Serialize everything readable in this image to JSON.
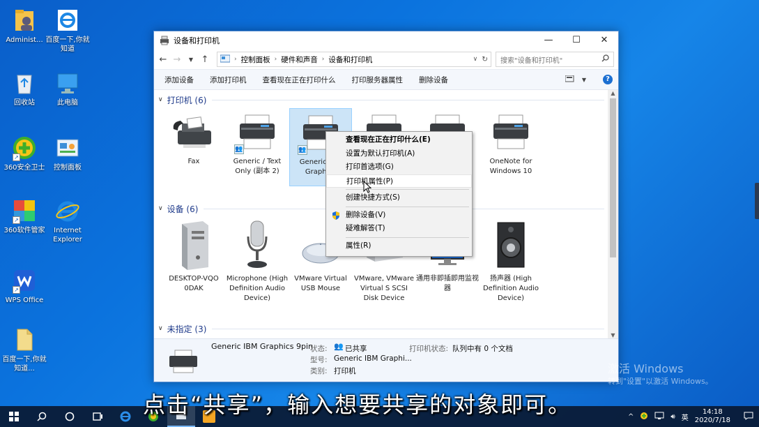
{
  "desktop": {
    "icons": [
      {
        "label": "Administ..."
      },
      {
        "label": "百度一下,你就知道"
      },
      {
        "label": "回收站"
      },
      {
        "label": "此电脑"
      },
      {
        "label": "360安全卫士"
      },
      {
        "label": "控制面板"
      },
      {
        "label": "360软件管家"
      },
      {
        "label": "Internet Explorer"
      },
      {
        "label": "WPS Office"
      },
      {
        "label": "百度一下,你就知道..."
      }
    ]
  },
  "window": {
    "title": "设备和打印机",
    "controls": {
      "minimize": "—",
      "maximize": "☐",
      "close": "✕"
    },
    "breadcrumb": [
      "控制面板",
      "硬件和声音",
      "设备和打印机"
    ],
    "search_placeholder": "搜索\"设备和打印机\"",
    "commands": [
      "添加设备",
      "添加打印机",
      "查看现在正在打印什么",
      "打印服务器属性",
      "删除设备"
    ],
    "help": "?"
  },
  "groups": {
    "printers": {
      "header": "打印机 (6)"
    },
    "devices": {
      "header": "设备 (6)"
    },
    "unspecified": {
      "header": "未指定 (3)"
    }
  },
  "printers": [
    {
      "label": "Fax"
    },
    {
      "label": "Generic / Text Only (副本 2)"
    },
    {
      "label": "Generic IBM Graphics"
    },
    {
      "label": ""
    },
    {
      "label": ""
    },
    {
      "label": "OneNote for Windows 10"
    }
  ],
  "devices": [
    {
      "label": "DESKTOP-VQO 0DAK"
    },
    {
      "label": "Microphone (High Definition Audio Device)"
    },
    {
      "label": "VMware Virtual USB Mouse"
    },
    {
      "label": "VMware, VMware Virtual S SCSI Disk Device"
    },
    {
      "label": "通用非即插即用监视器"
    },
    {
      "label": "扬声器 (High Definition Audio Device)"
    }
  ],
  "context_menu": {
    "items": [
      {
        "label": "查看现在正在打印什么(E)"
      },
      {
        "label": "设置为默认打印机(A)"
      },
      {
        "label": "打印首选项(G)"
      },
      {
        "label": "打印机属性(P)"
      },
      {
        "label": "创建快捷方式(S)"
      },
      {
        "label": "删除设备(V)"
      },
      {
        "label": "疑难解答(T)"
      },
      {
        "label": "属性(R)"
      }
    ]
  },
  "details": {
    "name": "Generic IBM Graphics 9pin",
    "state_label": "状态:",
    "state_value": "已共享",
    "model_label": "型号:",
    "model_value": "Generic IBM Graphi...",
    "category_label": "类别:",
    "category_value": "打印机",
    "printer_status_label": "打印机状态:",
    "printer_status_value": "队列中有 0 个文档"
  },
  "watermark": {
    "line1": "激活 Windows",
    "line2": "转到\"设置\"以激活 Windows。"
  },
  "subtitle": "点击“共享”，输入想要共享的对象即可。",
  "taskbar": {
    "ime": "英",
    "time": "14:18",
    "date": "2020/7/18"
  }
}
